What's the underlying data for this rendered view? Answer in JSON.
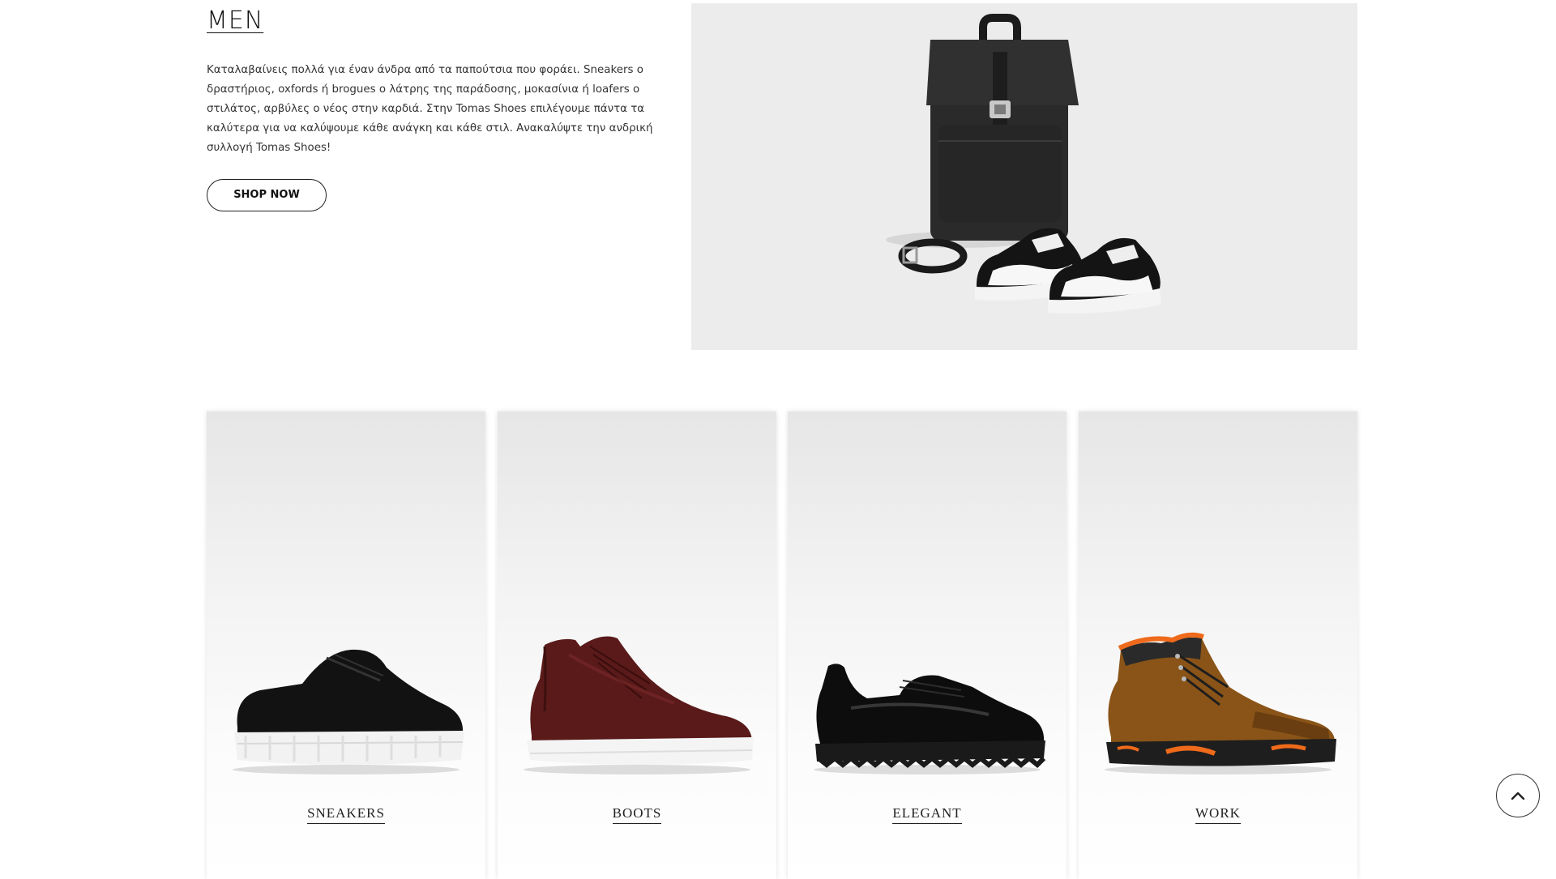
{
  "hero": {
    "title": "MEN",
    "description": "Καταλαβαίνεις πολλά για έναν άνδρα από τα παπούτσια που φοράει. Sneakers ο δραστήριος, oxfords ή brogues ο λάτρης της παράδοσης, μοκασίνια ή loafers ο στιλάτος, αρβύλες ο νέος στην καρδιά. Στην Tomas Shoes επιλέγουμε πάντα τα καλύτερα για να καλύψουμε κάθε ανάγκη και κάθε στιλ. Ανακαλύψτε την ανδρική συλλογή Tomas Shoes!",
    "button_label": "SHOP NOW",
    "image_icon": "backpack-belt-sneakers-photo"
  },
  "categories": [
    {
      "label": "SNEAKERS",
      "icon": "black-sneaker-photo"
    },
    {
      "label": "BOOTS",
      "icon": "burgundy-high-top-photo"
    },
    {
      "label": "ELEGANT",
      "icon": "black-derby-shoe-photo"
    },
    {
      "label": "WORK",
      "icon": "brown-work-boot-photo"
    }
  ],
  "scroll_top_icon": "chevron-up-icon",
  "colors": {
    "text": "#222222",
    "hero_bg": "#ececec",
    "card_top": "#e6e6e6",
    "work_boot_accent": "#ef6a1a"
  }
}
